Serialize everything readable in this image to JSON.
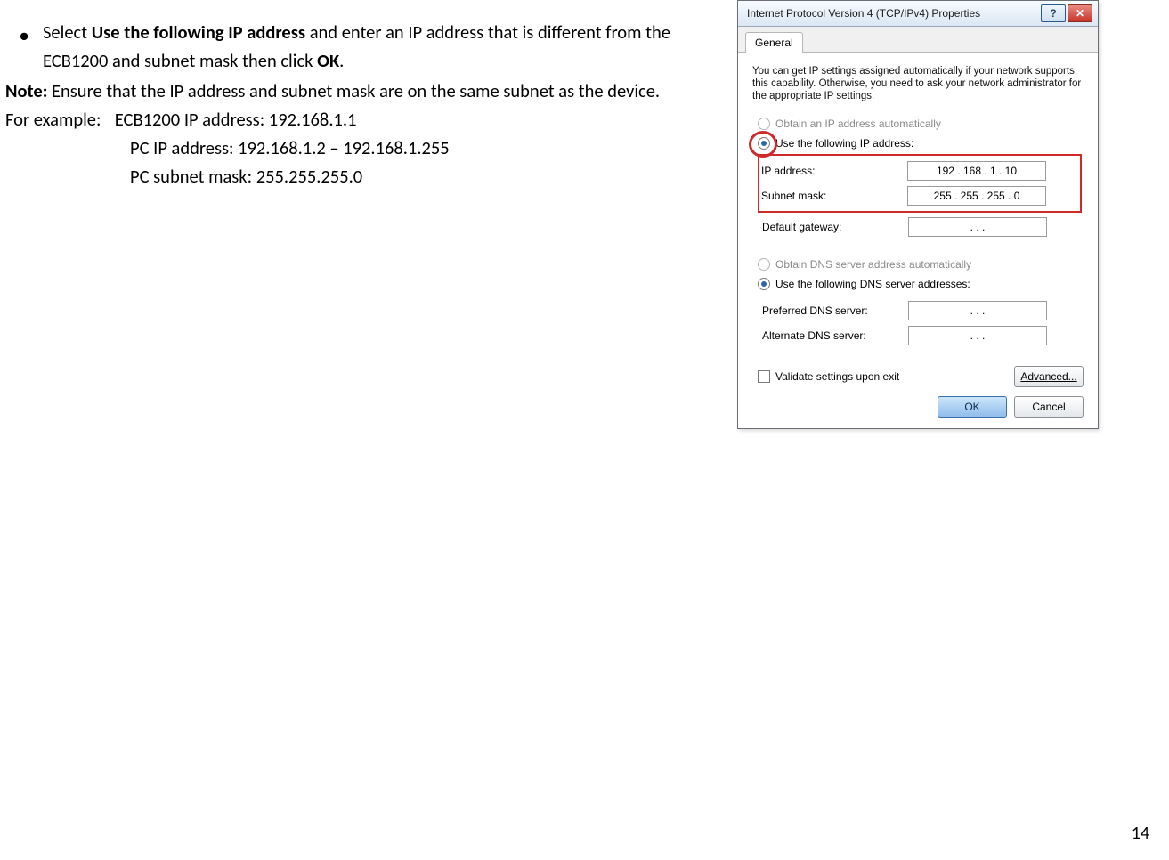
{
  "instructions": {
    "bullet_pre": "Select ",
    "bullet_bold": "Use the following IP address",
    "bullet_mid": " and enter an IP address that is different from the ECB1200 and subnet mask then click ",
    "bullet_bold2": "OK",
    "bullet_post": ".",
    "note_label": "Note:",
    "note_text": " Ensure that the IP address and subnet mask are on the same subnet as the device.",
    "example_label": "For example:",
    "ex1": "ECB1200 IP address: 192.168.1.1",
    "ex2": "PC IP address: 192.168.1.2 – 192.168.1.255",
    "ex3": "PC subnet mask: 255.255.255.0"
  },
  "page_number": "14",
  "dialog": {
    "title": "Internet Protocol Version 4 (TCP/IPv4) Properties",
    "help": "?",
    "close": "✕",
    "tab": "General",
    "description": "You can get IP settings assigned automatically if your network supports this capability. Otherwise, you need to ask your network administrator for the appropriate IP settings.",
    "radio_auto_ip": "Obtain an IP address automatically",
    "radio_manual_ip": "Use the following IP address:",
    "lbl_ip": "IP address:",
    "val_ip": "192 . 168 .   1   .  10",
    "lbl_mask": "Subnet mask:",
    "val_mask": "255 . 255 . 255 .   0",
    "lbl_gw": "Default gateway:",
    "val_gw": ".       .       .",
    "radio_auto_dns": "Obtain DNS server address automatically",
    "radio_manual_dns": "Use the following DNS server addresses:",
    "lbl_pref": "Preferred DNS server:",
    "val_pref": ".       .       .",
    "lbl_alt": "Alternate DNS server:",
    "val_alt": ".       .       .",
    "validate": "Validate settings upon exit",
    "advanced": "Advanced...",
    "ok": "OK",
    "cancel": "Cancel"
  }
}
